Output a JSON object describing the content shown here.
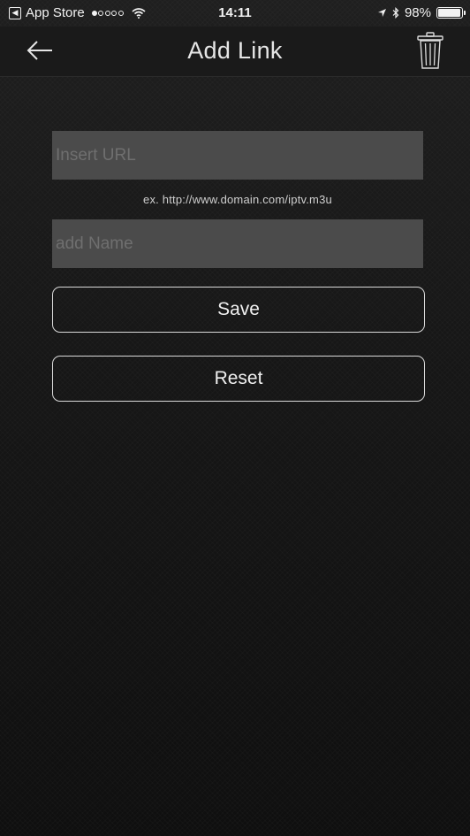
{
  "status_bar": {
    "back_app_label": "App Store",
    "signal_filled": 1,
    "signal_total": 5,
    "time": "14:11",
    "battery_text": "98%",
    "battery_level": 0.98
  },
  "nav": {
    "title": "Add Link",
    "back_icon": "arrow-left-icon",
    "trash_icon": "trash-icon"
  },
  "form": {
    "url_placeholder": "Insert URL",
    "url_value": "",
    "url_hint": "ex. http://www.domain.com/iptv.m3u",
    "name_placeholder": "add Name",
    "name_value": "",
    "save_label": "Save",
    "reset_label": "Reset"
  },
  "colors": {
    "background": "#161616",
    "field": "#4b4b4b",
    "button_border": "#d9d9d9",
    "text": "#e6e6e6"
  }
}
